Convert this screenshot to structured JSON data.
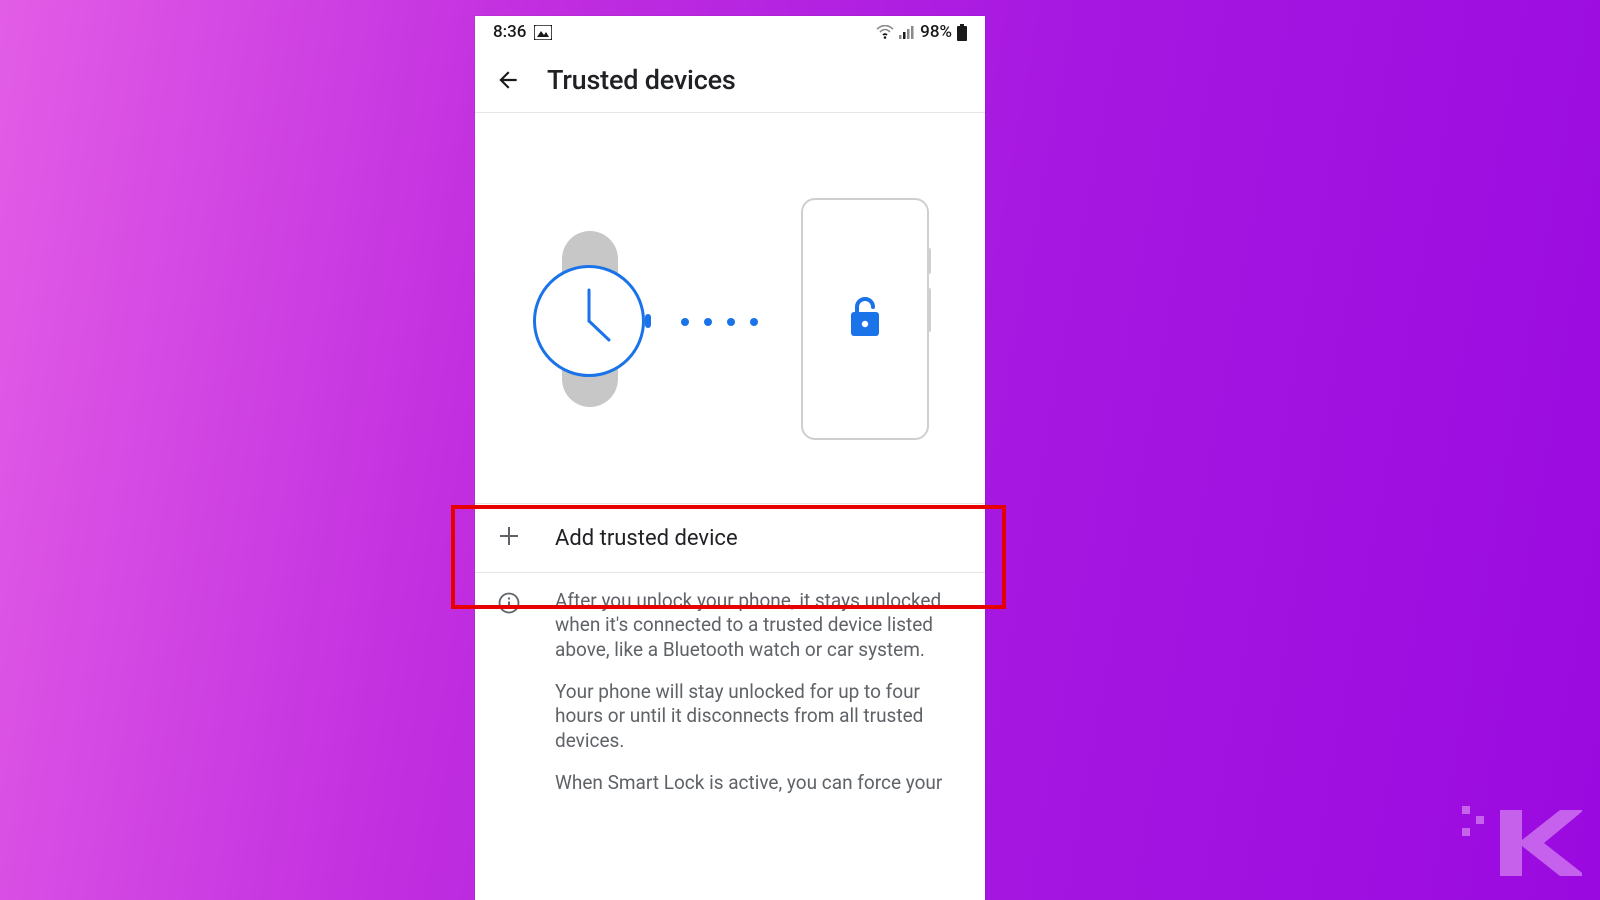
{
  "statusbar": {
    "time": "8:36",
    "battery_pct": "98%"
  },
  "appbar": {
    "title": "Trusted devices"
  },
  "add_row": {
    "label": "Add trusted device"
  },
  "info": {
    "p1": "After you unlock your phone, it stays unlocked when it's connected to a trusted device listed above, like a Bluetooth watch or car system.",
    "p2": "Your phone will stay unlocked for up to four hours or until it disconnects from all trusted devices.",
    "p3": "When Smart Lock is active, you can force your"
  }
}
